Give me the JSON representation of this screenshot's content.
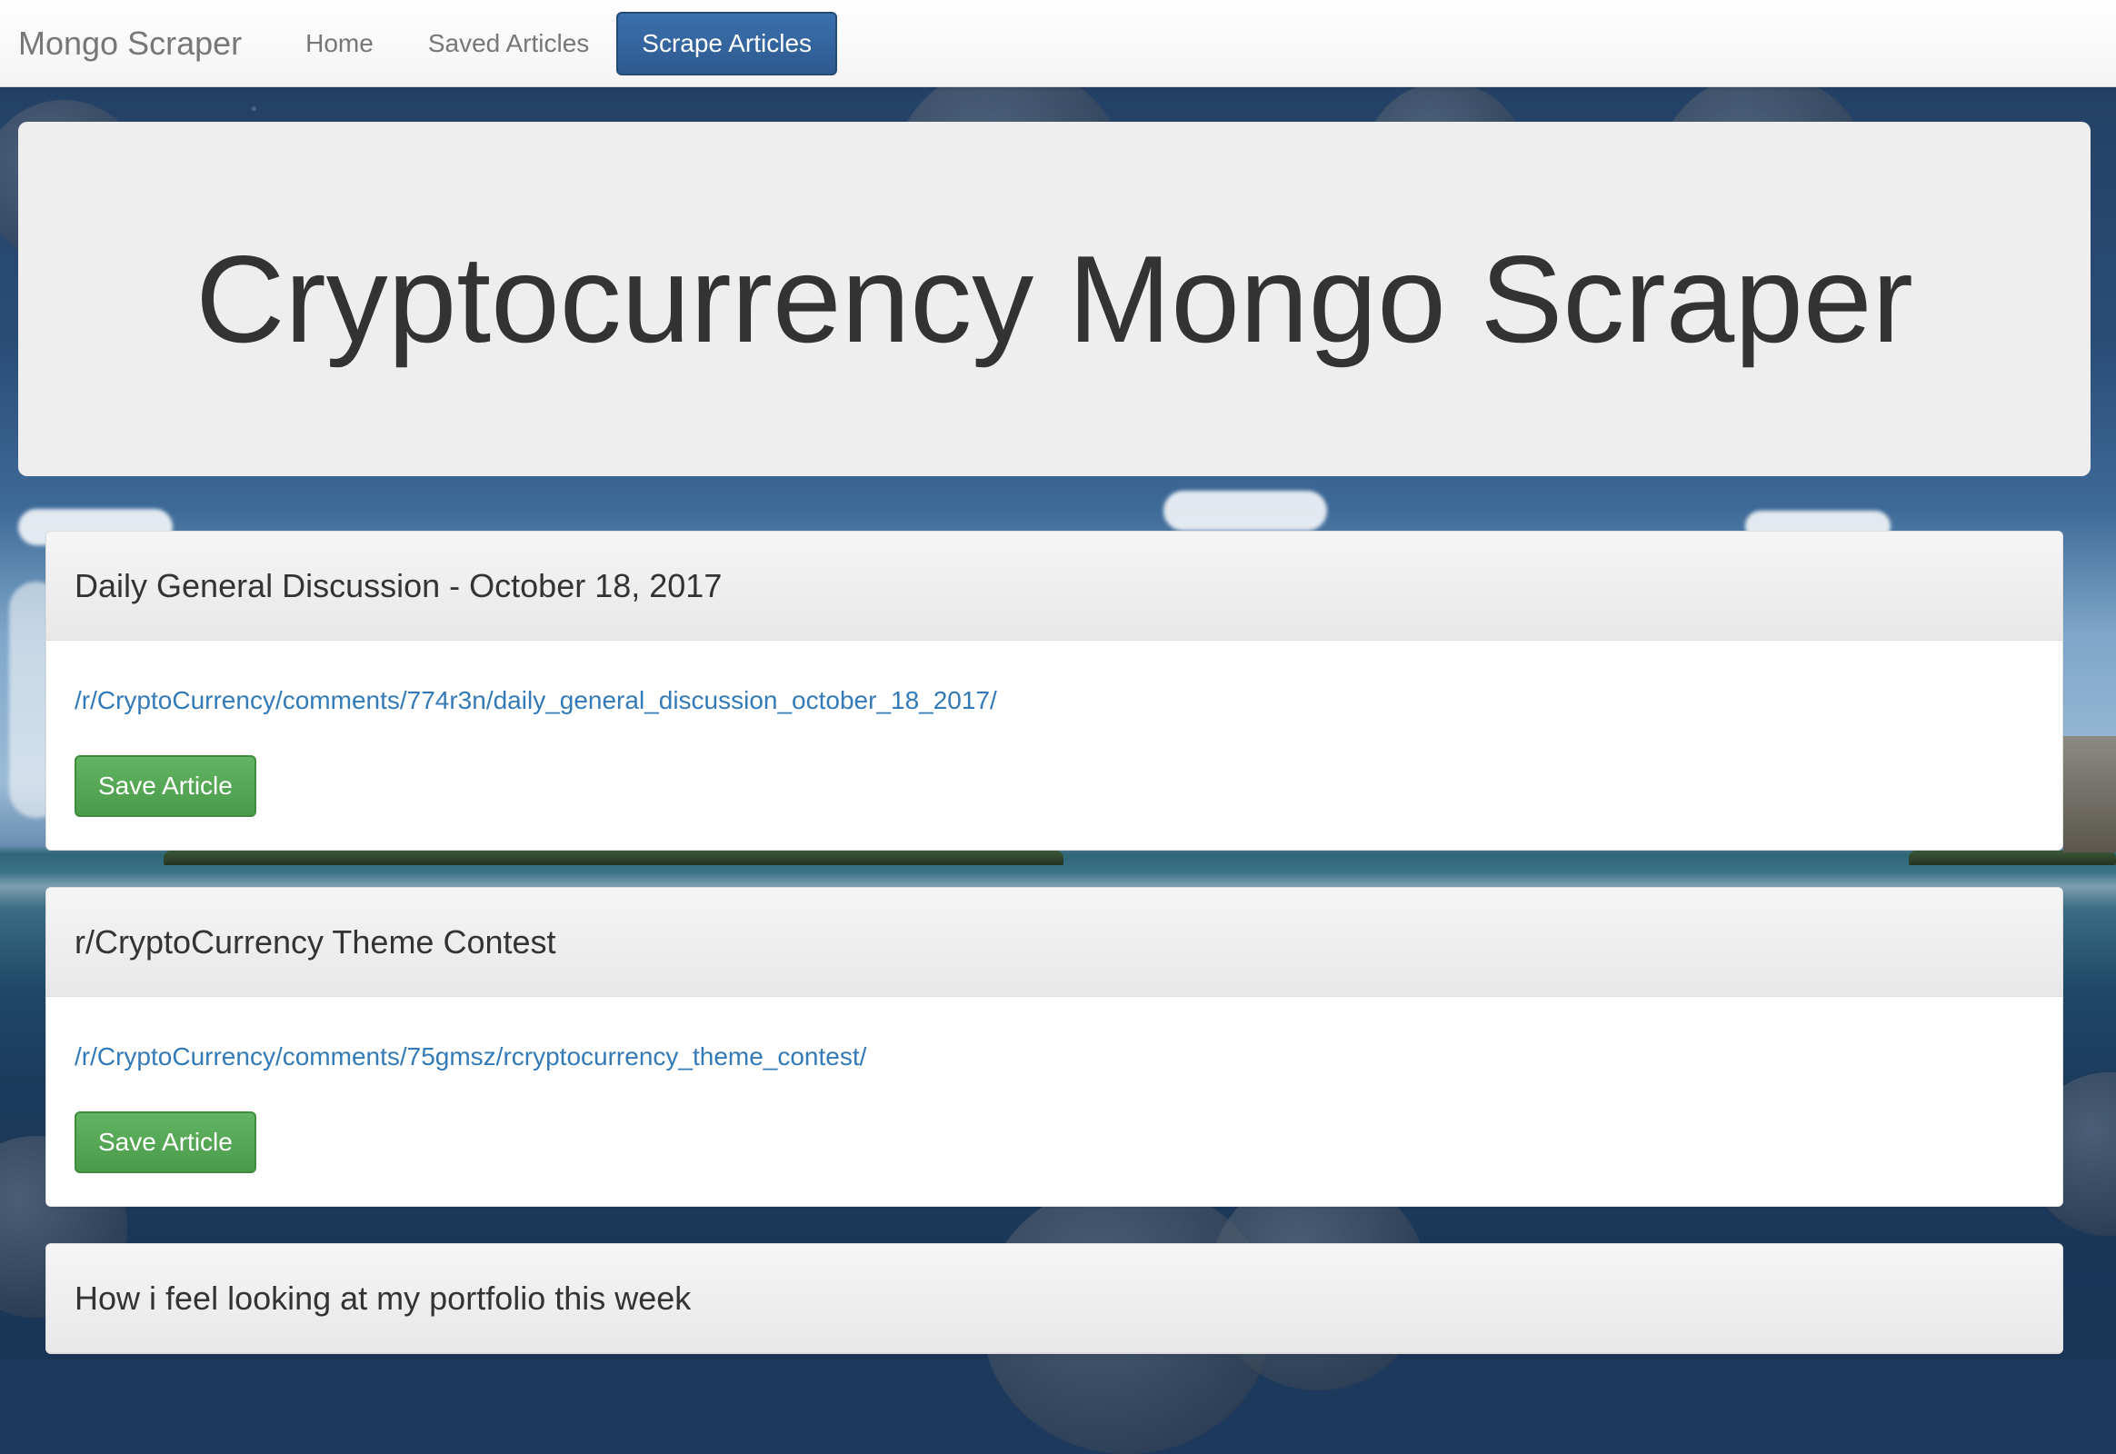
{
  "navbar": {
    "brand": "Mongo Scraper",
    "links": [
      {
        "label": "Home"
      },
      {
        "label": "Saved Articles"
      }
    ],
    "active_button": "Scrape Articles",
    "active_color": "#337ab7"
  },
  "jumbotron": {
    "title": "Cryptocurrency Mongo Scraper"
  },
  "articles": [
    {
      "title": "Daily General Discussion - October 18, 2017",
      "link": "/r/CryptoCurrency/comments/774r3n/daily_general_discussion_october_18_2017/",
      "button": "Save Article"
    },
    {
      "title": "r/CryptoCurrency Theme Contest",
      "link": "/r/CryptoCurrency/comments/75gmsz/rcryptocurrency_theme_contest/",
      "button": "Save Article"
    },
    {
      "title": "How i feel looking at my portfolio this week"
    }
  ],
  "colors": {
    "link": "#337ab7",
    "save_button": "#5cb85c",
    "jumbotron_bg": "#eeeeee"
  }
}
